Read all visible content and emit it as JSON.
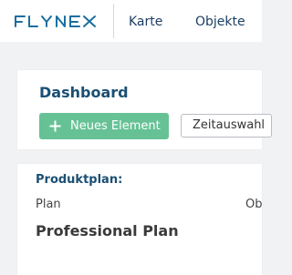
{
  "header": {
    "logo_text": "FLYNEX",
    "nav": [
      {
        "label": "Karte"
      },
      {
        "label": "Objekte"
      }
    ]
  },
  "dashboard": {
    "title": "Dashboard",
    "new_element_label": "Neues Element",
    "time_select_value": "Zeitauswahl"
  },
  "plan_card": {
    "heading": "Produktplan:",
    "label": "Plan",
    "label_2": "Ob",
    "value": "Professional Plan"
  },
  "colors": {
    "brand": "#1b6e9e",
    "button_green": "#66c295",
    "heading_blue": "#1b4f73"
  }
}
